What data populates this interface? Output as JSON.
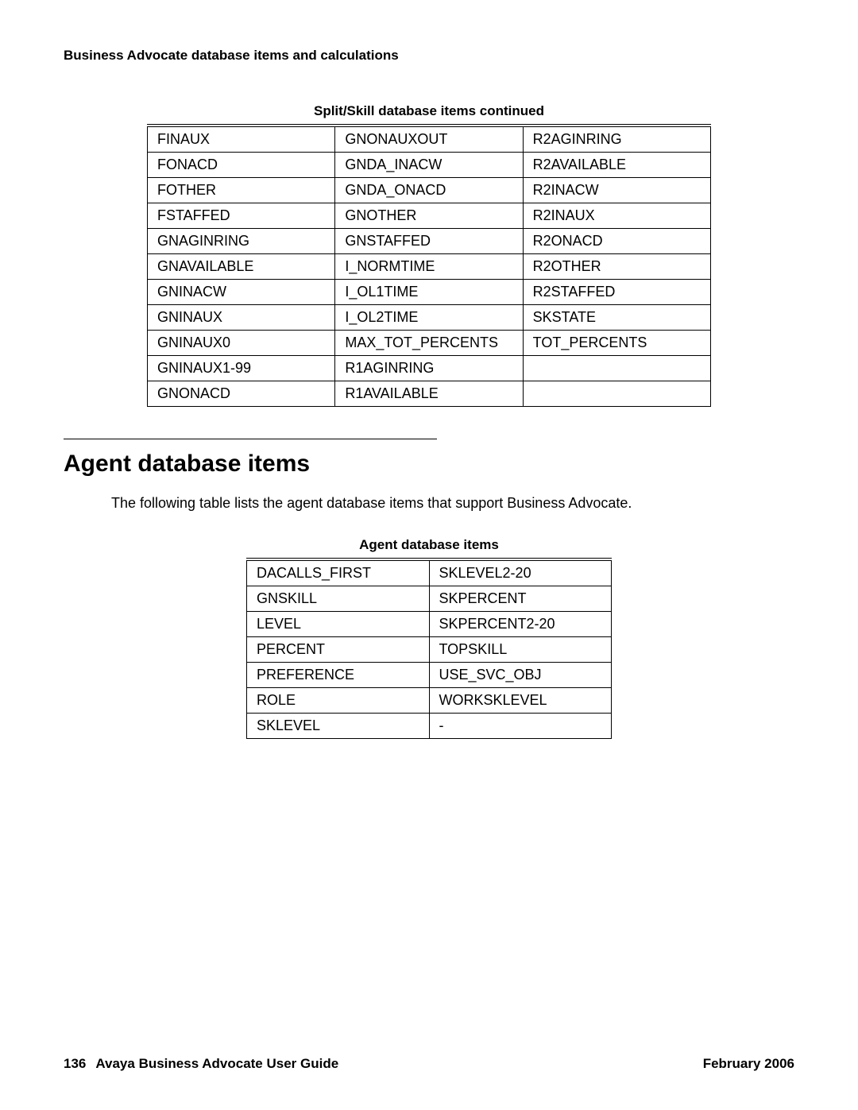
{
  "header": "Business Advocate database items and calculations",
  "splitTable": {
    "caption": "Split/Skill database items  continued",
    "rows": [
      [
        "FINAUX",
        "GNONAUXOUT",
        "R2AGINRING"
      ],
      [
        "FONACD",
        "GNDA_INACW",
        "R2AVAILABLE"
      ],
      [
        "FOTHER",
        "GNDA_ONACD",
        "R2INACW"
      ],
      [
        "FSTAFFED",
        "GNOTHER",
        "R2INAUX"
      ],
      [
        "GNAGINRING",
        "GNSTAFFED",
        "R2ONACD"
      ],
      [
        "GNAVAILABLE",
        "I_NORMTIME",
        "R2OTHER"
      ],
      [
        "GNINACW",
        "I_OL1TIME",
        "R2STAFFED"
      ],
      [
        "GNINAUX",
        "I_OL2TIME",
        "SKSTATE"
      ],
      [
        "GNINAUX0",
        "MAX_TOT_PERCENTS",
        "TOT_PERCENTS"
      ],
      [
        "GNINAUX1-99",
        "R1AGINRING",
        ""
      ],
      [
        "GNONACD",
        "R1AVAILABLE",
        ""
      ]
    ]
  },
  "section": {
    "heading": "Agent database items",
    "intro": "The following table lists the agent database items that support Business Advocate."
  },
  "agentTable": {
    "caption": "Agent database items",
    "rows": [
      [
        "DACALLS_FIRST",
        "SKLEVEL2-20"
      ],
      [
        "GNSKILL",
        "SKPERCENT"
      ],
      [
        "LEVEL",
        "SKPERCENT2-20"
      ],
      [
        "PERCENT",
        "TOPSKILL"
      ],
      [
        "PREFERENCE",
        "USE_SVC_OBJ"
      ],
      [
        "ROLE",
        "WORKSKLEVEL"
      ],
      [
        "SKLEVEL",
        "-"
      ]
    ]
  },
  "footer": {
    "pageNum": "136",
    "title": "Avaya Business Advocate User Guide",
    "date": "February 2006"
  }
}
